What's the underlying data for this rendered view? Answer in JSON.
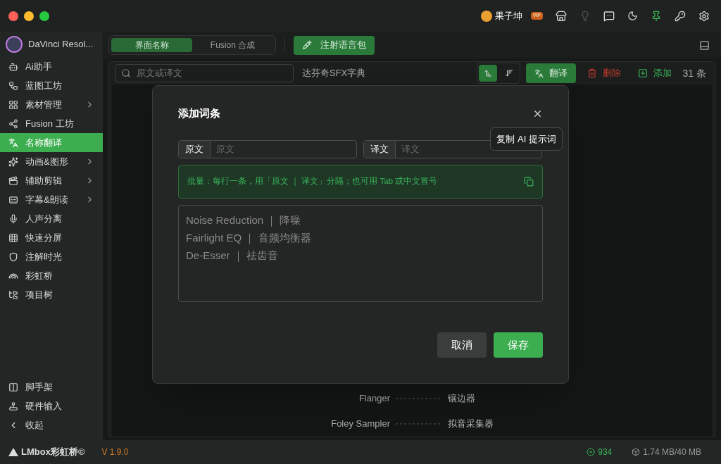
{
  "title_bar": {
    "user": {
      "name": "果子坤",
      "badge": "VIP"
    },
    "pin_active": true
  },
  "sidebar": {
    "app_name": "DaVinci Resol...",
    "items": [
      {
        "label": "Ai助手",
        "expandable": false,
        "selected": false
      },
      {
        "label": "蓝图工坊",
        "expandable": false,
        "selected": false
      },
      {
        "label": "素材管理",
        "expandable": true,
        "selected": false
      },
      {
        "label": "Fusion 工坊",
        "expandable": false,
        "selected": false
      },
      {
        "label": "名称翻译",
        "expandable": false,
        "selected": true
      },
      {
        "label": "动画&图形",
        "expandable": true,
        "selected": false
      },
      {
        "label": "辅助剪辑",
        "expandable": true,
        "selected": false
      },
      {
        "label": "字幕&朗读",
        "expandable": true,
        "selected": false
      },
      {
        "label": "人声分离",
        "expandable": false,
        "selected": false
      },
      {
        "label": "快速分屏",
        "expandable": false,
        "selected": false
      },
      {
        "label": "注解时光",
        "expandable": false,
        "selected": false
      },
      {
        "label": "彩虹桥",
        "expandable": false,
        "selected": false
      },
      {
        "label": "项目树",
        "expandable": false,
        "selected": false
      }
    ],
    "bottom_items": [
      {
        "label": "脚手架"
      },
      {
        "label": "硬件输入"
      },
      {
        "label": "收起"
      }
    ]
  },
  "tabs": [
    {
      "label": "界面名称",
      "selected": true
    },
    {
      "label": "Fusion 合成",
      "selected": false
    }
  ],
  "inject_button": "注射语言包",
  "toolbar": {
    "search_placeholder": "原文或译文",
    "dictionary": "达芬奇SFX字典",
    "sort_buttons": [
      {
        "selected": true
      },
      {
        "selected": false
      }
    ],
    "translate": "翻译",
    "delete": "删除",
    "add": "添加",
    "count": "31 条"
  },
  "rows": [
    {
      "source": "Flanger",
      "target": "镶边器"
    },
    {
      "source": "Foley Sampler",
      "target": "拟音采集器"
    }
  ],
  "dialog": {
    "title": "添加词条",
    "source_label": "原文",
    "source_placeholder": "原文",
    "target_label": "译文",
    "target_placeholder": "译文",
    "tooltip": "复制 AI 提示词",
    "hint": "批量：每行一条，用「原文 ｜ 译文」分隔；也可用 Tab 或中文冒号",
    "batch_placeholder": [
      "Noise Reduction ｜ 降噪",
      "Fairlight EQ ｜ 音频均衡器",
      "De-Esser ｜ 祛齿音"
    ],
    "cancel": "取消",
    "save": "保存"
  },
  "status_bar": {
    "brand": "LMbox彩虹桥©",
    "version": "V 1.9.0",
    "points": "934",
    "storage": "1.74 MB/40 MB"
  }
}
